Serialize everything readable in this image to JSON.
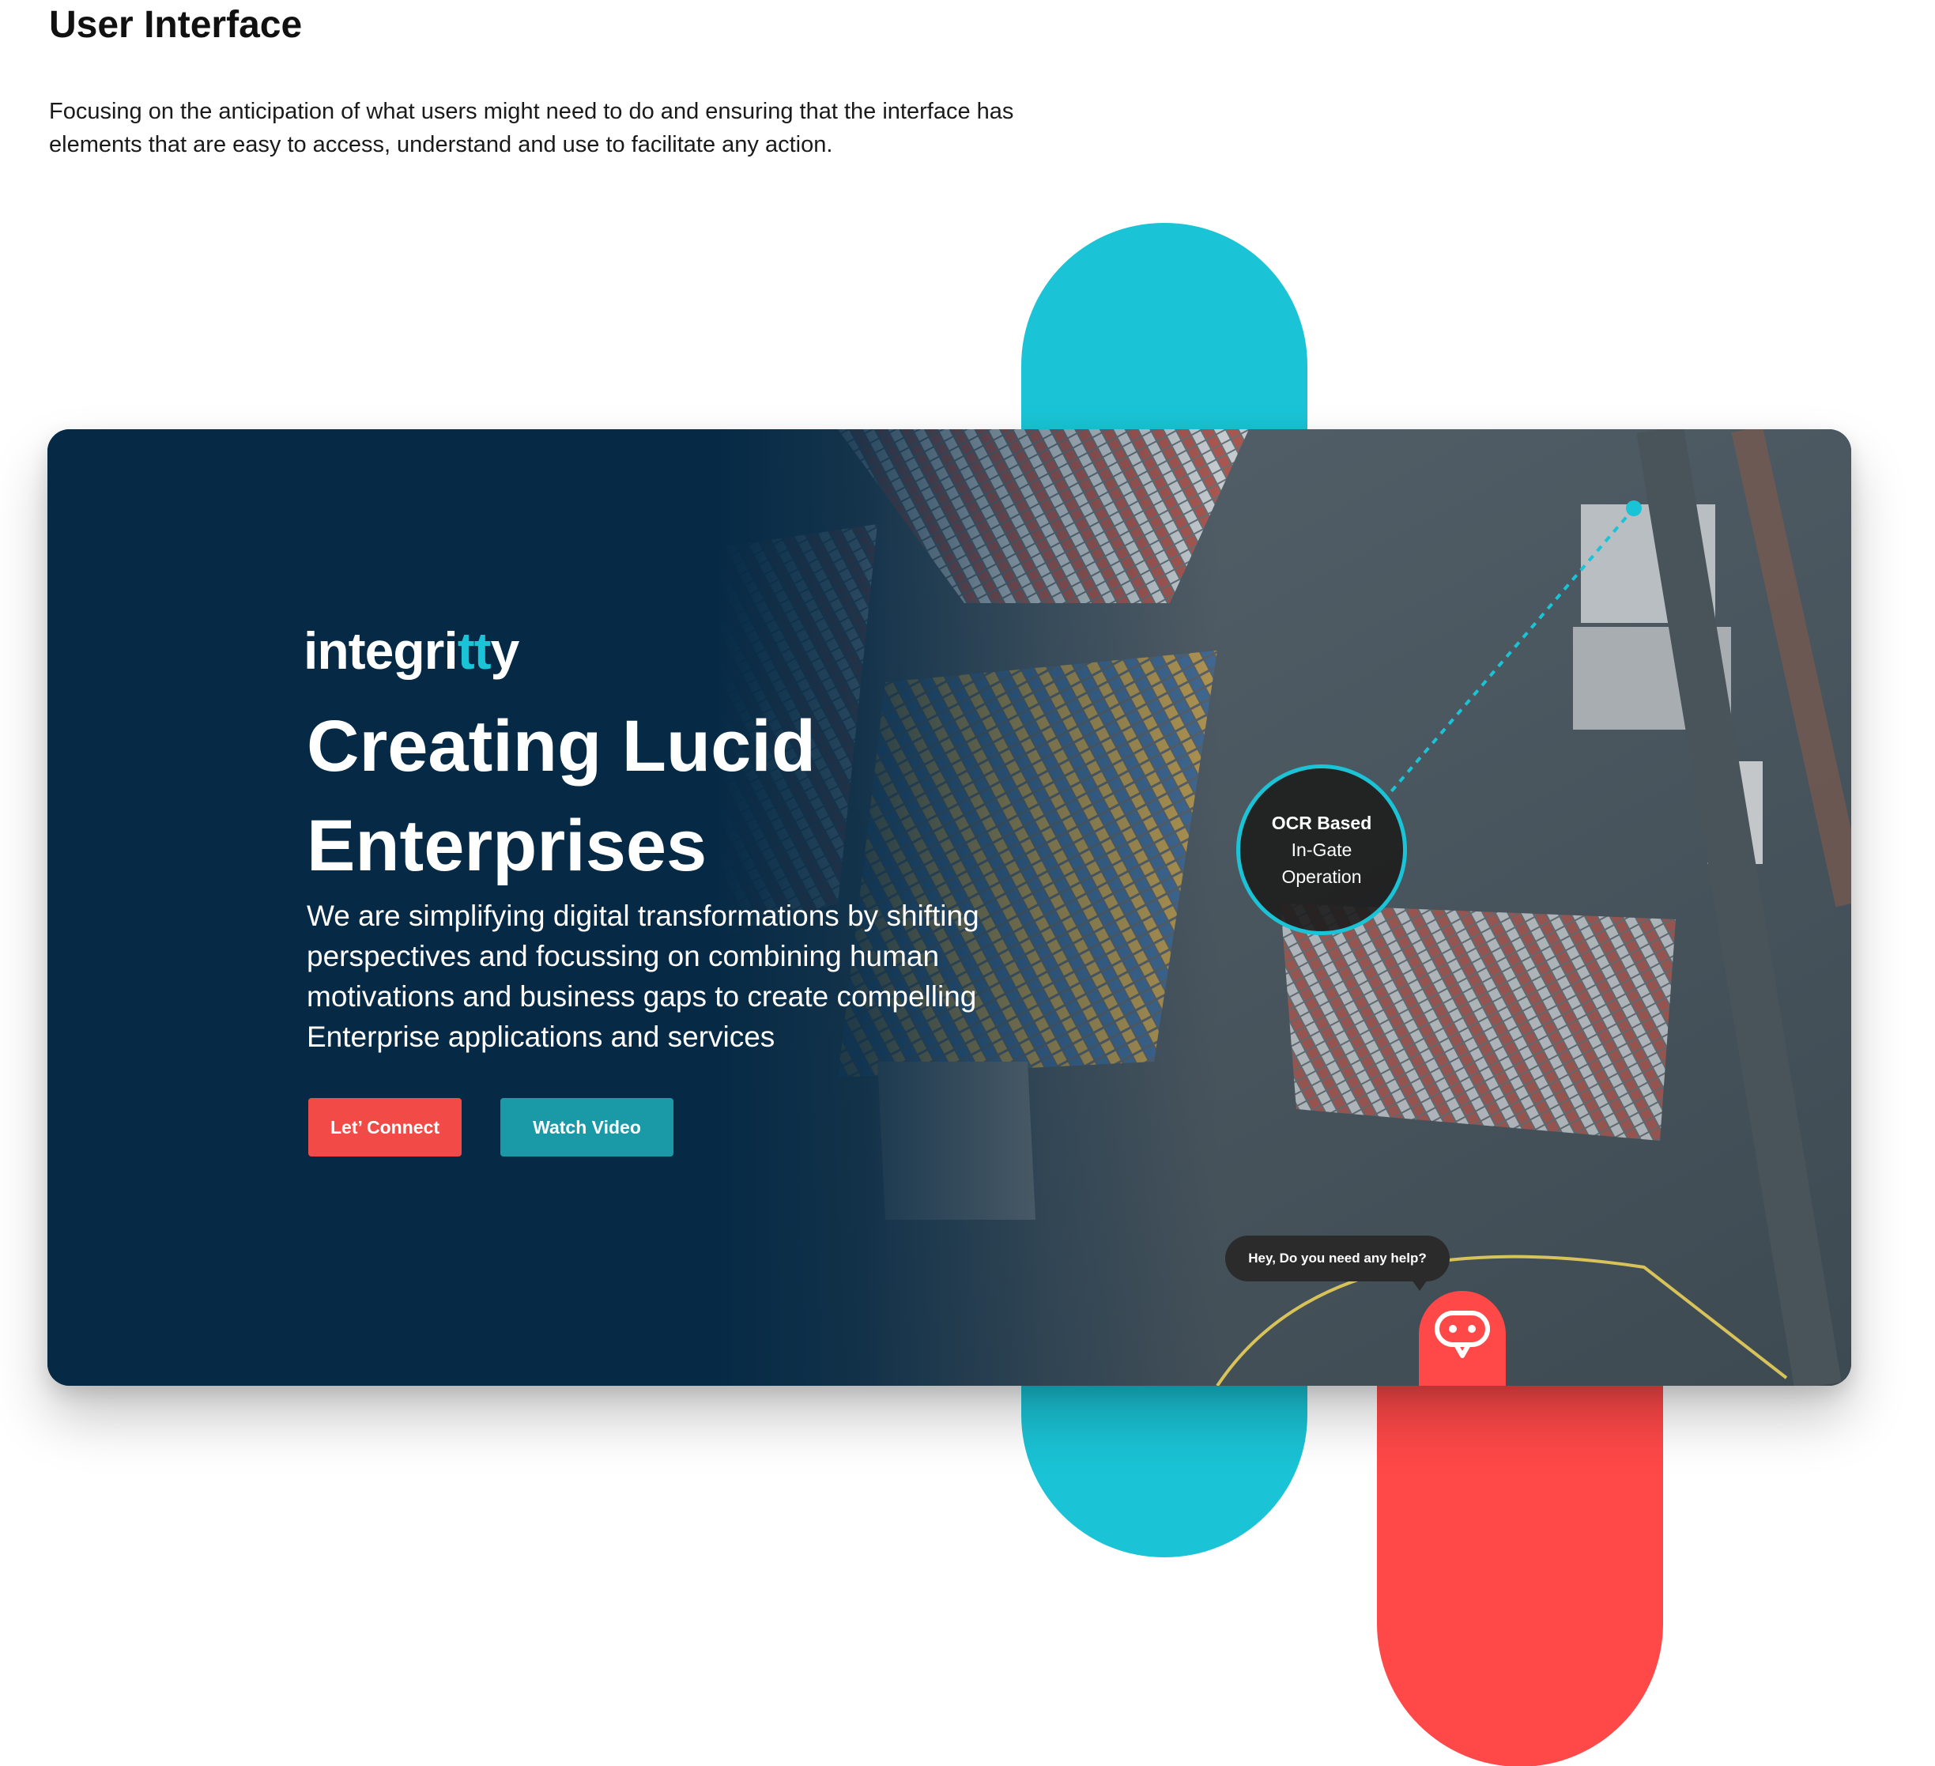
{
  "section": {
    "title": "User Interface",
    "description": "Focusing on the anticipation of what users might need to do and ensuring that the interface has elements that are easy to access, understand and use to facilitate any action."
  },
  "hero": {
    "logo_prefix": "integri",
    "logo_accent": "tt",
    "logo_suffix": "y",
    "headline_line1": "Creating Lucid",
    "headline_line2": "Enterprises",
    "subtext": "We are simplifying digital transformations by shifting perspectives and focussing on combining human motivations and business gaps to create compelling Enterprise applications and services",
    "connect_button": "Let’ Connect",
    "video_button": "Watch Video"
  },
  "ocr_callout": {
    "title": "OCR Based",
    "line2": "In-Gate",
    "line3": "Operation"
  },
  "chat": {
    "prompt": "Hey, Do you need any help?",
    "icon": "chatbot-icon"
  },
  "colors": {
    "teal": "#1ac3d5",
    "red": "#ff4848",
    "navy": "#062a45",
    "button_red": "#f24a47",
    "button_teal": "#1a9aa7"
  }
}
